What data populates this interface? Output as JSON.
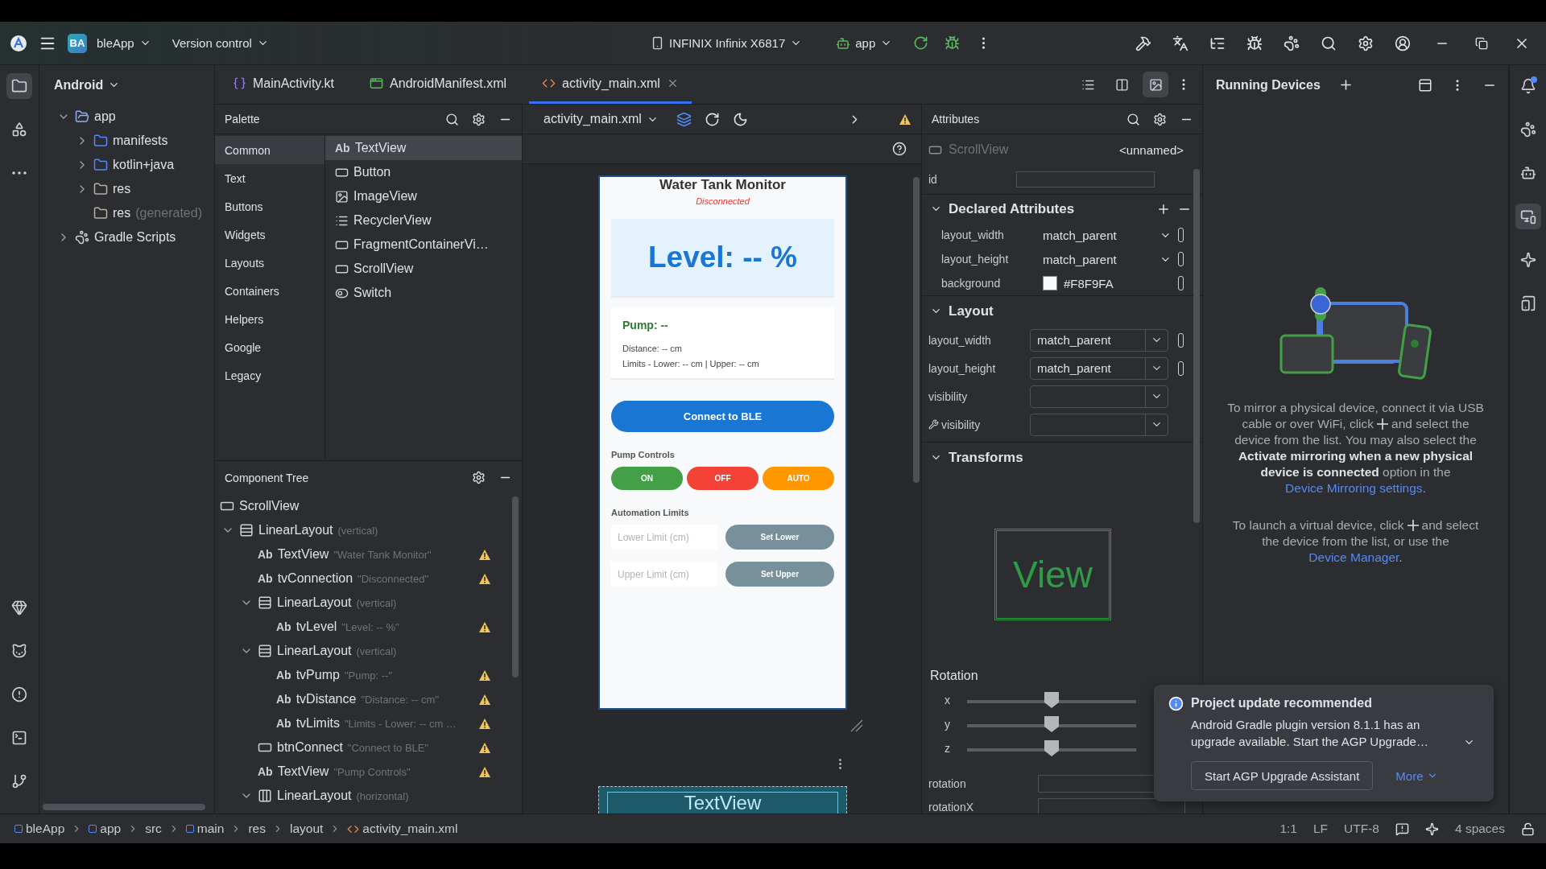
{
  "toolbar": {
    "project_badge": "BA",
    "project": "bleApp",
    "vcs": "Version control",
    "device": "INFINIX Infinix X6817",
    "run_config": "app"
  },
  "left_tools": [
    {
      "kind": "project",
      "selected": true
    },
    {
      "kind": "structure",
      "selected": false
    },
    {
      "kind": "more",
      "selected": false
    },
    {
      "kind": "gem",
      "selected": false
    },
    {
      "kind": "cat",
      "selected": false
    },
    {
      "kind": "problems",
      "selected": false
    },
    {
      "kind": "terminal",
      "selected": false
    },
    {
      "kind": "git",
      "selected": false
    }
  ],
  "right_tools": [
    {
      "kind": "notifications",
      "selected": false
    },
    {
      "kind": "gradle",
      "selected": false
    },
    {
      "kind": "device_manager",
      "selected": false
    },
    {
      "kind": "running_devices",
      "selected": true
    },
    {
      "kind": "gemini",
      "selected": false
    },
    {
      "kind": "mirroring",
      "selected": false
    }
  ],
  "project_panel": {
    "view": "Android",
    "tree": [
      {
        "label": "app",
        "kind": "module",
        "expanded": true,
        "children": [
          {
            "label": "manifests",
            "kind": "folder",
            "expanded": false
          },
          {
            "label": "kotlin+java",
            "kind": "folder",
            "expanded": false
          },
          {
            "label": "res",
            "kind": "res",
            "expanded": false
          },
          {
            "label": "res",
            "note": "(generated)",
            "kind": "res"
          }
        ]
      },
      {
        "label": "Gradle Scripts",
        "kind": "gradle",
        "expanded": false
      }
    ]
  },
  "editor_tabs": [
    {
      "label": "MainActivity.kt",
      "kind": "kotlin",
      "selected": false
    },
    {
      "label": "AndroidManifest.xml",
      "kind": "manifest",
      "selected": false
    },
    {
      "label": "activity_main.xml",
      "kind": "xml",
      "selected": true
    }
  ],
  "view_modes": [
    {
      "kind": "code",
      "selected": false
    },
    {
      "kind": "split",
      "selected": false
    },
    {
      "kind": "design",
      "selected": true
    }
  ],
  "palette": {
    "title": "Palette",
    "categories": [
      {
        "label": "Common",
        "selected": true
      },
      {
        "label": "Text",
        "selected": false
      },
      {
        "label": "Buttons",
        "selected": false
      },
      {
        "label": "Widgets",
        "selected": false
      },
      {
        "label": "Layouts",
        "selected": false
      },
      {
        "label": "Containers",
        "selected": false
      },
      {
        "label": "Helpers",
        "selected": false
      },
      {
        "label": "Google",
        "selected": false
      },
      {
        "label": "Legacy",
        "selected": false
      }
    ],
    "items": [
      {
        "kind": "text",
        "glyph": "Ab",
        "label": "TextView",
        "selected": true
      },
      {
        "kind": "button",
        "label": "Button",
        "selected": false
      },
      {
        "kind": "image",
        "label": "ImageView",
        "selected": false
      },
      {
        "kind": "list",
        "label": "RecyclerView",
        "selected": false
      },
      {
        "kind": "frame",
        "label": "FragmentContainerVi…",
        "selected": false
      },
      {
        "kind": "frame",
        "label": "ScrollView",
        "selected": false
      },
      {
        "kind": "switch",
        "label": "Switch",
        "selected": false
      }
    ]
  },
  "component_tree": {
    "title": "Component Tree",
    "root": {
      "name": "ScrollView",
      "kind": "frame",
      "warning": false,
      "children": [
        {
          "name": "LinearLayout",
          "detail": "(vertical)",
          "kind": "vertical",
          "warning": false,
          "expanded": true,
          "children": [
            {
              "name": "TextView",
              "detail": "\"Water Tank Monitor\"",
              "kind": "text",
              "glyph": "Ab",
              "warning": true
            },
            {
              "name": "tvConnection",
              "detail": "\"Disconnected\"",
              "kind": "text",
              "glyph": "Ab",
              "warning": true
            },
            {
              "name": "LinearLayout",
              "detail": "(vertical)",
              "kind": "vertical",
              "warning": false,
              "expanded": true,
              "children": [
                {
                  "name": "tvLevel",
                  "detail": "\"Level: -- %\"",
                  "kind": "text",
                  "glyph": "Ab",
                  "warning": true
                }
              ]
            },
            {
              "name": "LinearLayout",
              "detail": "(vertical)",
              "kind": "vertical",
              "warning": false,
              "expanded": true,
              "children": [
                {
                  "name": "tvPump",
                  "detail": "\"Pump: --\"",
                  "kind": "text",
                  "glyph": "Ab",
                  "warning": true
                },
                {
                  "name": "tvDistance",
                  "detail": "\"Distance: -- cm\"",
                  "kind": "text",
                  "glyph": "Ab",
                  "warning": true
                },
                {
                  "name": "tvLimits",
                  "detail": "\"Limits - Lower: -- cm …",
                  "kind": "text",
                  "glyph": "Ab",
                  "warning": true
                }
              ]
            },
            {
              "name": "btnConnect",
              "detail": "\"Connect to BLE\"",
              "kind": "button",
              "warning": true
            },
            {
              "name": "TextView",
              "detail": "\"Pump Controls\"",
              "kind": "text",
              "glyph": "Ab",
              "warning": true
            },
            {
              "name": "LinearLayout",
              "detail": "(horizontal)",
              "kind": "horizontal",
              "warning": false,
              "expanded": true
            }
          ]
        }
      ]
    }
  },
  "design": {
    "file": "activity_main.xml",
    "blueprint_label": "TextView",
    "preview": {
      "title": "Water Tank Monitor",
      "status": "Disconnected",
      "level": "Level: -- %",
      "pump": "Pump: --",
      "distance": "Distance: -- cm",
      "limits": "Limits - Lower: -- cm | Upper: -- cm",
      "connect": "Connect to BLE",
      "controls_label": "Pump Controls",
      "controls": [
        {
          "label": "ON",
          "color": "#43a047"
        },
        {
          "label": "OFF",
          "color": "#f44336"
        },
        {
          "label": "AUTO",
          "color": "#ff9800"
        }
      ],
      "limits_label": "Automation Limits",
      "limit_inputs": [
        {
          "placeholder": "Lower Limit (cm)",
          "button": "Set Lower"
        },
        {
          "placeholder": "Upper Limit (cm)",
          "button": "Set Upper"
        }
      ]
    }
  },
  "attributes": {
    "title": "Attributes",
    "component": "ScrollView",
    "component_id": "<unnamed>",
    "id_label": "id",
    "sections": [
      {
        "title": "Declared Attributes",
        "expanded": true,
        "rows": [
          {
            "name": "layout_width",
            "value": "match_parent",
            "kind": "inline_dropdown"
          },
          {
            "name": "layout_height",
            "value": "match_parent",
            "kind": "inline_dropdown"
          },
          {
            "name": "background",
            "value": "#F8F9FA",
            "kind": "color",
            "color": "#f8f9fa"
          }
        ]
      },
      {
        "title": "Layout",
        "expanded": true,
        "rows": [
          {
            "name": "layout_width",
            "value": "match_parent",
            "kind": "dropdown"
          },
          {
            "name": "layout_height",
            "value": "match_parent",
            "kind": "dropdown"
          },
          {
            "name": "visibility",
            "kind": "dropdown"
          },
          {
            "name": "visibility",
            "kind": "tools_dropdown"
          }
        ]
      }
    ],
    "transforms": {
      "title": "Transforms",
      "expanded": true,
      "preview": "View",
      "rotation_title": "Rotation",
      "sliders": [
        {
          "axis": "x",
          "level": 0.5
        },
        {
          "axis": "y",
          "level": 0.5
        },
        {
          "axis": "z",
          "level": 0.5
        }
      ],
      "fields": [
        "rotation",
        "rotationX"
      ]
    }
  },
  "running_devices": {
    "title": "Running Devices",
    "mirror_text": {
      "before_plus": "To mirror a physical device, connect it via USB cable or over WiFi, click",
      "after_plus": "and select the device from the list. You may also select the **Activate mirroring when a new physical device is connected** option in the",
      "link": "Device Mirroring settings",
      "end": "."
    },
    "virtual_text": {
      "before_plus": "To launch a virtual device, click",
      "after_plus": "and select the device from the list, or use the",
      "link": "Device Manager",
      "end": "."
    }
  },
  "notification": {
    "title": "Project update recommended",
    "body": "Android Gradle plugin version 8.1.1 has an upgrade available. Start the AGP Upgrade…",
    "action": "Start AGP Upgrade Assistant",
    "more": "More"
  },
  "status_bar": {
    "breadcrumbs": [
      {
        "label": "bleApp",
        "kind": "module"
      },
      {
        "label": "app",
        "kind": "module"
      },
      {
        "label": "src",
        "kind": "plain"
      },
      {
        "label": "main",
        "kind": "module"
      },
      {
        "label": "res",
        "kind": "plain"
      },
      {
        "label": "layout",
        "kind": "plain"
      },
      {
        "label": "activity_main.xml",
        "kind": "xml"
      }
    ],
    "position": "1:1",
    "line_ending": "LF",
    "encoding": "UTF-8",
    "indent": "4 spaces"
  }
}
